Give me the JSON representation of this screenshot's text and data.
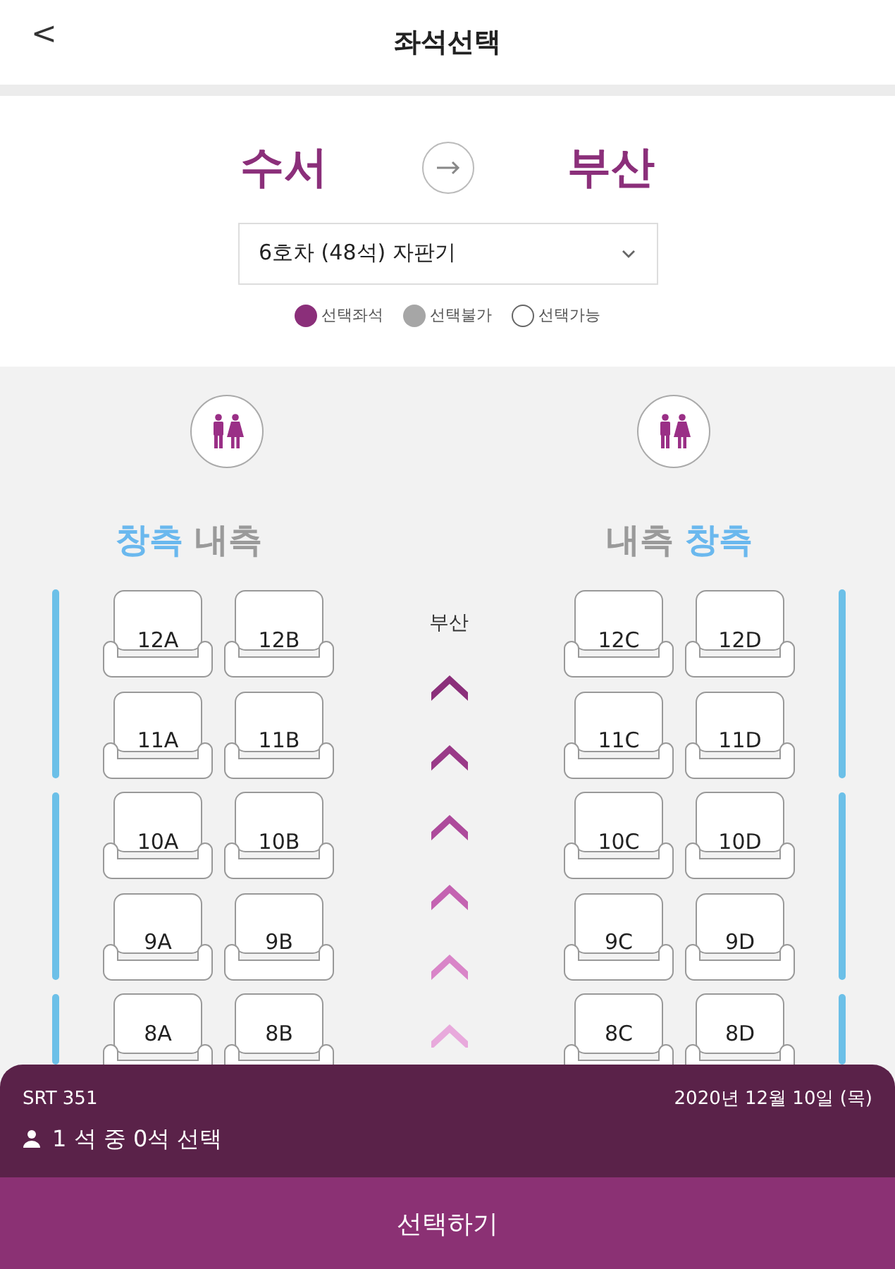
{
  "header": {
    "back": "<",
    "title": "좌석선택"
  },
  "route": {
    "from": "수서",
    "to": "부산"
  },
  "car_select": {
    "value": "6호차 (48석) 자판기"
  },
  "legend": [
    {
      "kind": "selected",
      "label": "선택좌석"
    },
    {
      "kind": "unavailable",
      "label": "선택불가"
    },
    {
      "kind": "available",
      "label": "선택가능"
    }
  ],
  "sides": [
    {
      "labels": [
        {
          "text": "창측",
          "kind": "window"
        },
        {
          "text": "내측",
          "kind": "aisle"
        }
      ]
    },
    {
      "labels": [
        {
          "text": "내측",
          "kind": "aisle"
        },
        {
          "text": "창측",
          "kind": "window"
        }
      ]
    }
  ],
  "direction_label": "부산",
  "seat_rows": [
    {
      "seats": [
        {
          "label": "12A",
          "selected": false,
          "disabled": false
        },
        {
          "label": "12B",
          "selected": false,
          "disabled": false
        },
        {
          "label": "12C",
          "selected": false,
          "disabled": false
        },
        {
          "label": "12D",
          "selected": false,
          "disabled": false
        }
      ]
    },
    {
      "seats": [
        {
          "label": "11A",
          "selected": false,
          "disabled": false
        },
        {
          "label": "11B",
          "selected": false,
          "disabled": false
        },
        {
          "label": "11C",
          "selected": false,
          "disabled": false
        },
        {
          "label": "11D",
          "selected": false,
          "disabled": false
        }
      ]
    },
    {
      "seats": [
        {
          "label": "10A",
          "selected": false,
          "disabled": false
        },
        {
          "label": "10B",
          "selected": false,
          "disabled": false
        },
        {
          "label": "10C",
          "selected": false,
          "disabled": false
        },
        {
          "label": "10D",
          "selected": false,
          "disabled": false
        }
      ]
    },
    {
      "seats": [
        {
          "label": "9A",
          "selected": false,
          "disabled": false
        },
        {
          "label": "9B",
          "selected": false,
          "disabled": false
        },
        {
          "label": "9C",
          "selected": false,
          "disabled": false
        },
        {
          "label": "9D",
          "selected": false,
          "disabled": false
        }
      ]
    },
    {
      "seats": [
        {
          "label": "8A",
          "selected": false,
          "disabled": false
        },
        {
          "label": "8B",
          "selected": false,
          "disabled": false
        },
        {
          "label": "8C",
          "selected": false,
          "disabled": false
        },
        {
          "label": "8D",
          "selected": false,
          "disabled": false
        }
      ]
    }
  ],
  "summary": {
    "train": "SRT 351",
    "date": "2020년 12월 10일 (목)",
    "count": "1 석 중 0석 선택"
  },
  "submit": "선택하기"
}
